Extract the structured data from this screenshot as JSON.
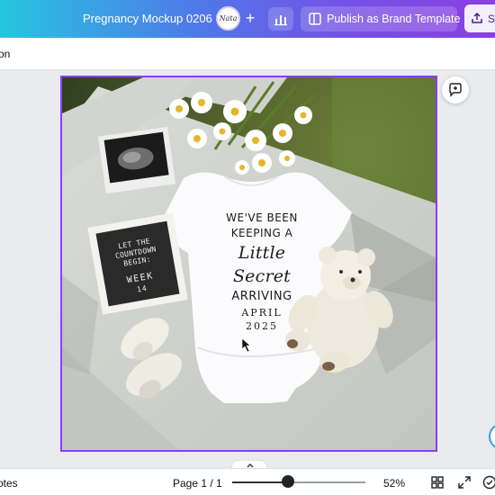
{
  "header": {
    "doc_title": "Pregnancy Mockup 0206",
    "avatar_initials": "Nata",
    "add_icon": "plus-icon",
    "insights_icon": "bar-chart-icon",
    "publish_label": "Publish as Brand Template",
    "publish_icon": "template-icon",
    "share_label": "S",
    "share_icon": "upload-icon",
    "gradient": [
      "#27c5e0",
      "#7450e6",
      "#8b3fe0"
    ]
  },
  "toolbar": {
    "cut_label": "on"
  },
  "design": {
    "onesie_text": {
      "line1": "WE'VE BEEN",
      "line2": "KEEPING A",
      "script": "Little Secret",
      "arriving": "ARRIVING",
      "month": "APRIL",
      "year": "2025"
    },
    "letterboard": {
      "line1": "LET THE",
      "line2": "COUNTDOWN",
      "line3": "BEGIN:",
      "week": "WEEK",
      "number": "14"
    },
    "selection_color": "#8b3dff"
  },
  "comment_icon": "add-comment-icon",
  "footer": {
    "notes_label": "otes",
    "page_indicator": "Page 1 / 1",
    "zoom_label": "52%",
    "zoom_fraction": 0.42,
    "icons": [
      "grid-view-icon",
      "fullscreen-icon",
      "check-circle-icon"
    ]
  }
}
